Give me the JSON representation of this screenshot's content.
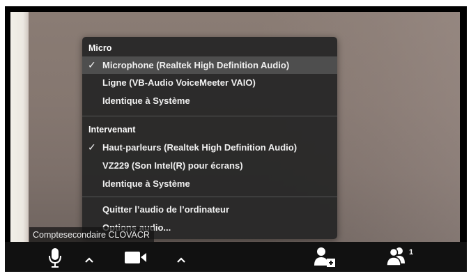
{
  "audio_menu": {
    "microphone_section": {
      "header": "Micro",
      "items": [
        {
          "label": "Microphone (Realtek High Definition Audio)",
          "checked": true,
          "check_mark": "✓"
        },
        {
          "label": "Ligne (VB-Audio VoiceMeeter VAIO)",
          "checked": false,
          "check_mark": ""
        },
        {
          "label": "Identique à Système",
          "checked": false,
          "check_mark": ""
        }
      ]
    },
    "speaker_section": {
      "header": "Intervenant",
      "items": [
        {
          "label": "Haut-parleurs (Realtek High Definition Audio)",
          "checked": true,
          "check_mark": "✓"
        },
        {
          "label": "VZ229 (Son Intel(R) pour écrans)",
          "checked": false,
          "check_mark": ""
        },
        {
          "label": "Identique à Système",
          "checked": false,
          "check_mark": ""
        }
      ]
    },
    "actions": [
      {
        "label": "Quitter l’audio de l’ordinateur"
      },
      {
        "label": "Options audio..."
      }
    ]
  },
  "video_tooltip": {
    "text": "Comptesecondaire CLOVACR"
  },
  "toolbar": {
    "icons": {
      "mic": "microphone-icon",
      "mic_options": "chevron-up-icon",
      "camera": "video-camera-icon",
      "camera_options": "chevron-up-icon",
      "invite": "add-participant-icon",
      "participants": "participants-icon"
    },
    "participants_count": "1"
  },
  "colors": {
    "menu_background": "#262626",
    "menu_selected": "#555555",
    "toolbar_background": "#111111",
    "text": "#ffffff"
  }
}
